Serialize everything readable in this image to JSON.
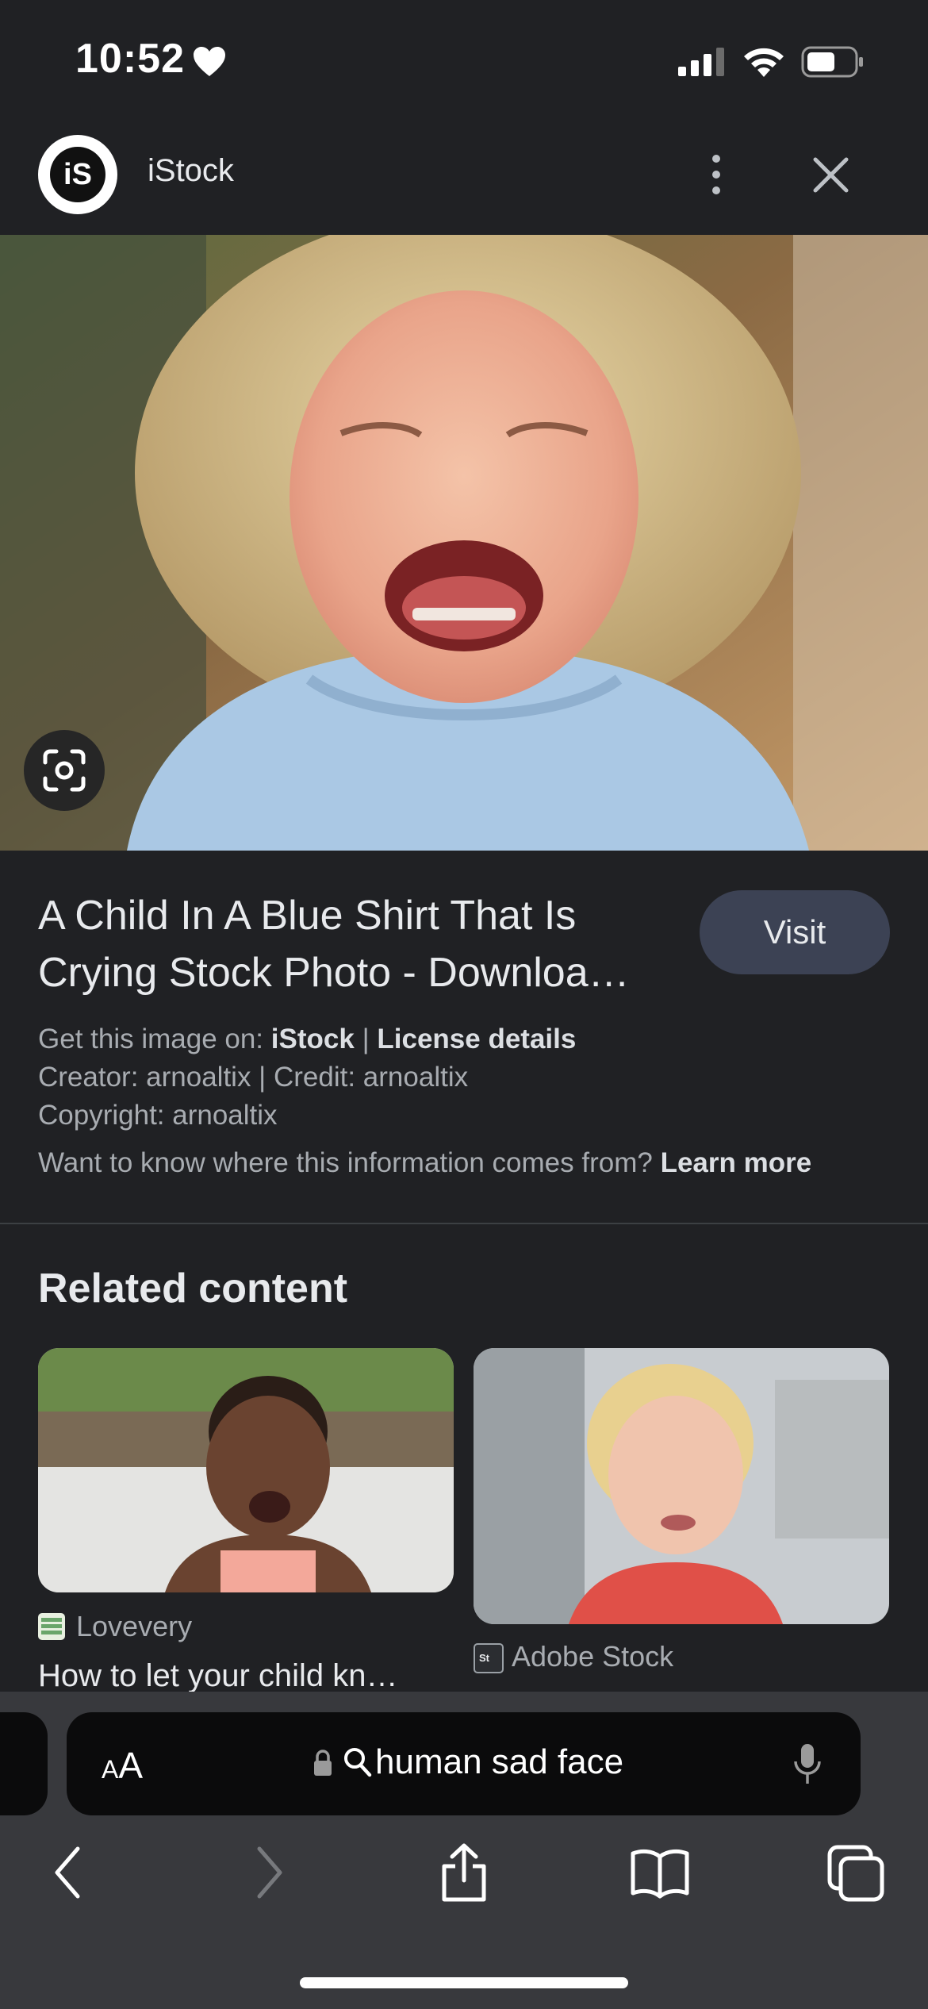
{
  "status": {
    "time": "10:52"
  },
  "header": {
    "site_logo_text": "iS",
    "site_name": "iStock"
  },
  "result": {
    "title": "A Child In A Blue Shirt That Is Crying Stock Photo - Downloa…",
    "visit_label": "Visit",
    "get_image_prefix": "Get this image on:",
    "get_image_source": "iStock",
    "separator": "|",
    "license_label": "License details",
    "creator_line": "Creator: arnoaltix | Credit: arnoaltix",
    "copyright_line": "Copyright: arnoaltix",
    "info_question": "Want to know where this information comes from?",
    "learn_more": "Learn more"
  },
  "related": {
    "heading": "Related content",
    "cards": [
      {
        "source": "Lovevery",
        "title": "How to let your child kn…"
      },
      {
        "source": "Adobe Stock",
        "title": ""
      }
    ]
  },
  "browser": {
    "aa_label_big": "A",
    "aa_label_small": "A",
    "url_text": "human sad face"
  },
  "icons": {
    "heart": "heart-icon",
    "signal": "cellular-signal-icon",
    "wifi": "wifi-icon",
    "battery": "battery-icon",
    "more": "more-vert-icon",
    "close": "close-icon",
    "lens": "google-lens-icon",
    "lock": "lock-icon",
    "search": "search-icon",
    "mic": "microphone-icon",
    "back": "back-chevron-icon",
    "forward": "forward-chevron-icon",
    "share": "share-icon",
    "bookmarks": "bookmarks-book-icon",
    "tabs": "tabs-icon"
  },
  "colors": {
    "background": "#202124",
    "visit_button": "#3c4254",
    "toolbar": "#38393d"
  }
}
